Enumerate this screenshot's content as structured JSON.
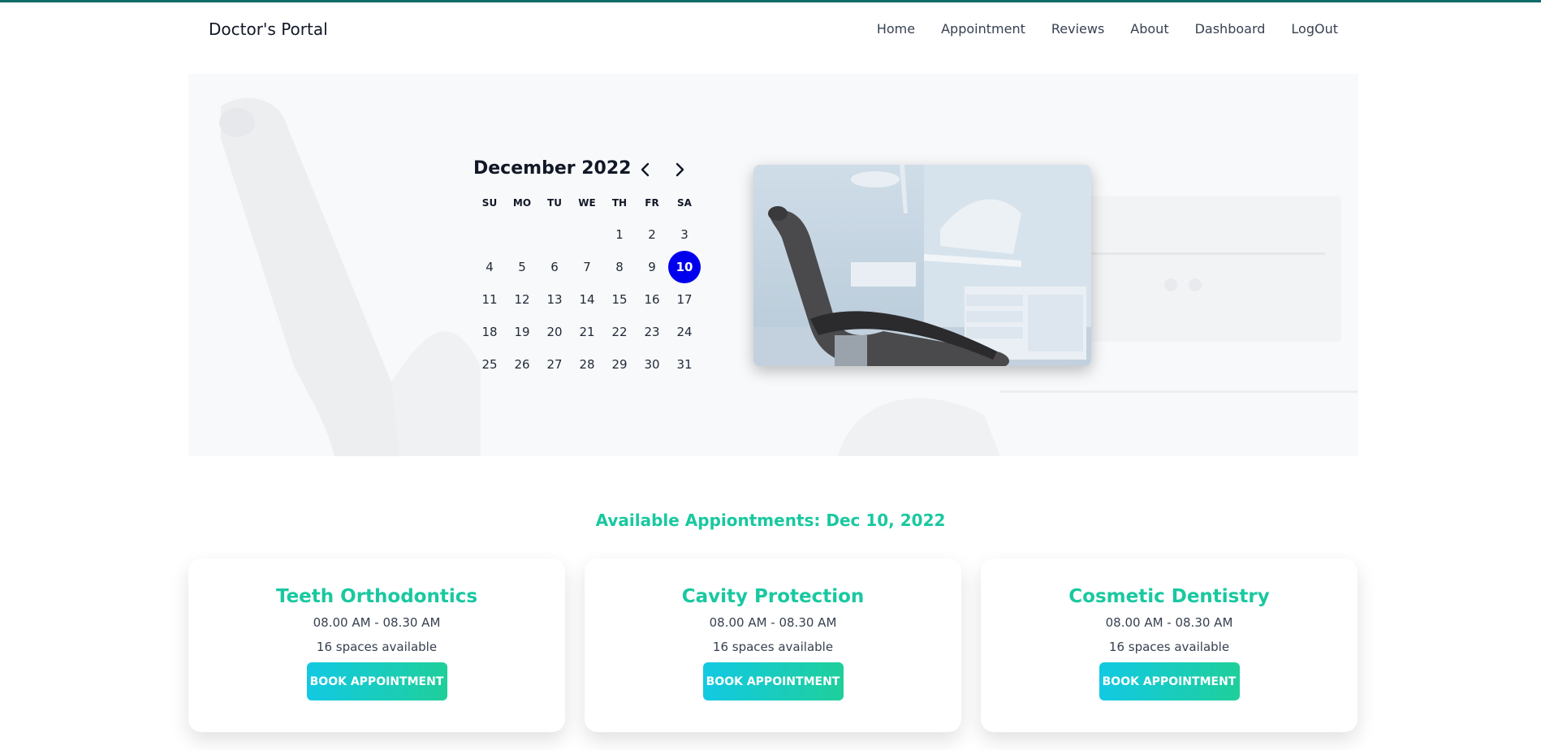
{
  "app": {
    "brand": "Doctor's Portal"
  },
  "nav": {
    "items": [
      "Home",
      "Appointment",
      "Reviews",
      "About",
      "Dashboard",
      "LogOut"
    ]
  },
  "calendar": {
    "month_label": "December 2022",
    "weekdays": [
      "SU",
      "MO",
      "TU",
      "WE",
      "TH",
      "FR",
      "SA"
    ],
    "leading_blanks": 4,
    "days_in_month": 31,
    "selected_day": 10,
    "selected_color": "#0000ee"
  },
  "appointments": {
    "title": "Available Appiontments: Dec 10, 2022",
    "services": [
      {
        "name": "Teeth Orthodontics",
        "time": "08.00 AM - 08.30 AM",
        "spaces": "16 spaces available",
        "button": "BOOK APPOINTMENT"
      },
      {
        "name": "Cavity Protection",
        "time": "08.00 AM - 08.30 AM",
        "spaces": "16 spaces available",
        "button": "BOOK APPOINTMENT"
      },
      {
        "name": "Cosmetic Dentistry",
        "time": "08.00 AM - 08.30 AM",
        "spaces": "16 spaces available",
        "button": "BOOK APPOINTMENT"
      }
    ]
  },
  "colors": {
    "accent": "#19c8a0",
    "button_gradient_start": "#12c9e3",
    "button_gradient_end": "#1fcf9a",
    "topbar": "#0f6b68"
  }
}
